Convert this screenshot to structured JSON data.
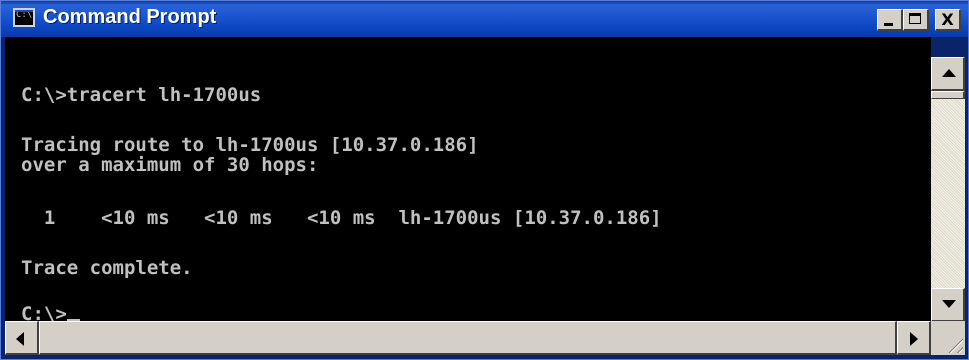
{
  "window": {
    "title": "Command Prompt",
    "icon": "console-icon",
    "icon_text": "C:\\",
    "controls": {
      "minimize": "minimize-icon",
      "maximize": "maximize-icon",
      "close_label": "X"
    }
  },
  "console": {
    "lines": [
      "C:\\>tracert lh-1700us",
      "Tracing route to lh-1700us [10.37.0.186]",
      "over a maximum of 30 hops:",
      "  1    <10 ms   <10 ms   <10 ms  lh-1700us [10.37.0.186]",
      "Trace complete.",
      "C:\\>"
    ]
  },
  "colors": {
    "console_background": "#000000",
    "console_text": "#c0c0c0",
    "titlebar": "#0a46c0"
  }
}
